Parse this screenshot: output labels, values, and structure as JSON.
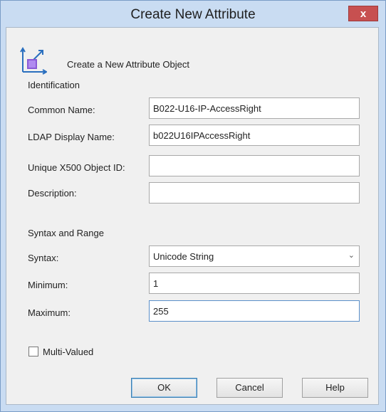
{
  "window": {
    "title": "Create New Attribute",
    "close_label": "x"
  },
  "header": {
    "text": "Create a New Attribute Object"
  },
  "identification": {
    "heading": "Identification",
    "common_name": {
      "label": "Common Name:",
      "value": "B022-U16-IP-AccessRight"
    },
    "ldap_display_name": {
      "label": "LDAP Display Name:",
      "value": "b022U16IPAccessRight"
    },
    "x500_oid": {
      "label": "Unique X500 Object ID:",
      "value": ""
    },
    "description": {
      "label": "Description:",
      "value": ""
    }
  },
  "syntax_range": {
    "heading": "Syntax and Range",
    "syntax": {
      "label": "Syntax:",
      "value": "Unicode String"
    },
    "minimum": {
      "label": "Minimum:",
      "value": "1"
    },
    "maximum": {
      "label": "Maximum:",
      "value": "255"
    }
  },
  "multi_valued": {
    "label": "Multi-Valued",
    "checked": false
  },
  "buttons": {
    "ok": "OK",
    "cancel": "Cancel",
    "help": "Help"
  },
  "colors": {
    "title_bar": "#c9dcf2",
    "close": "#c75050",
    "dialog_bg": "#f0f0f0",
    "icon_purple": "#8a5ad6"
  }
}
